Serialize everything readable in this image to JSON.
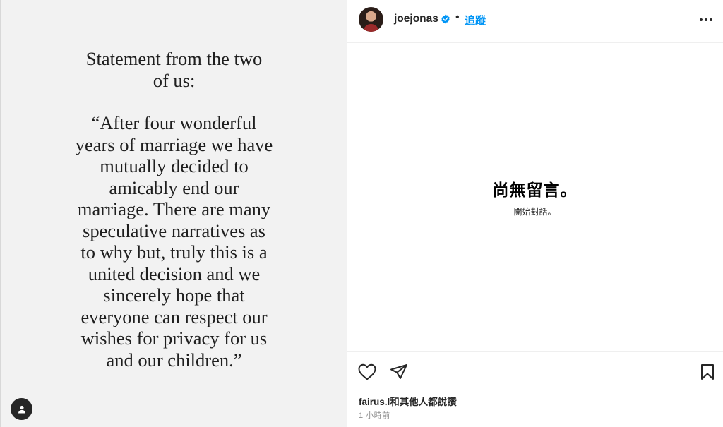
{
  "post_image": {
    "statement_lines": [
      "Statement from the two",
      "of us:",
      "",
      "“After four wonderful",
      "years of marriage we have",
      "mutually decided to",
      "amicably end our",
      "marriage. There are many",
      "speculative narratives as",
      "to why but, truly this is a",
      "united decision and we",
      "sincerely hope that",
      "everyone can respect our",
      "wishes for privacy for us",
      "and our children.”"
    ],
    "user_tag_icon": "person-icon"
  },
  "header": {
    "username": "joejonas",
    "verified_icon": "verified-badge-icon",
    "separator": "•",
    "follow_label": "追蹤",
    "more_icon": "more-options-icon"
  },
  "comments": {
    "empty_title": "尚無留言。",
    "empty_subtitle": "開始對話。"
  },
  "actions": {
    "like_icon": "heart-icon",
    "share_icon": "paper-plane-icon",
    "save_icon": "bookmark-icon"
  },
  "footer": {
    "likes_text": "fairus.l和其他人都說讚",
    "timestamp": "1 小時前"
  },
  "colors": {
    "accent": "#0095f6",
    "left_background": "#f2f2f2",
    "text_primary": "#262626",
    "text_muted": "#8e8e8e"
  }
}
